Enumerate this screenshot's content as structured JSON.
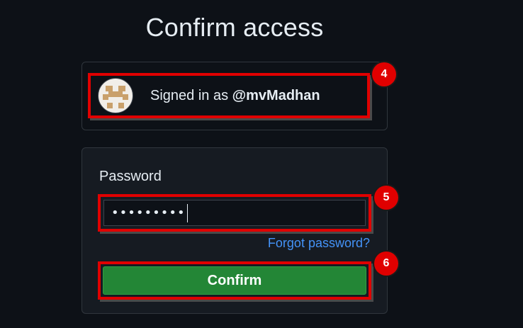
{
  "page": {
    "title": "Confirm access"
  },
  "signed_in": {
    "prefix": "Signed in as ",
    "username": "@mvMadhan"
  },
  "form": {
    "password_label": "Password",
    "password_value": "•••••••••",
    "forgot_link": "Forgot password?",
    "confirm_label": "Confirm"
  },
  "markers": {
    "m4": "4",
    "m5": "5",
    "m6": "6"
  },
  "colors": {
    "background": "#0d1117",
    "card": "#161b22",
    "highlight": "#e00000",
    "confirm_button": "#238636",
    "link": "#4493f8"
  },
  "icons": {
    "avatar": "identicon-avatar"
  }
}
